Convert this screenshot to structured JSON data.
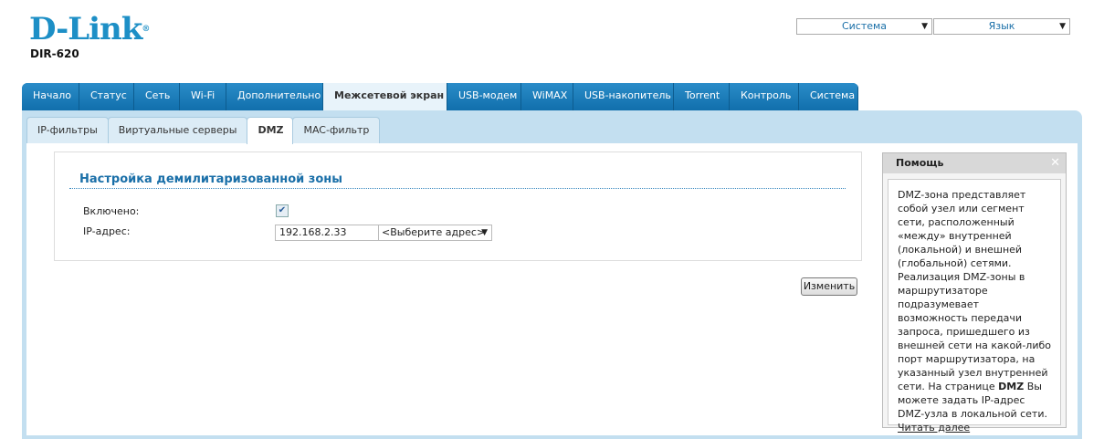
{
  "brand": {
    "logo": "D-Link",
    "model": "DIR-620"
  },
  "top": {
    "system": "Система",
    "language": "Язык"
  },
  "tabs": [
    "Начало",
    "Статус",
    "Сеть",
    "Wi-Fi",
    "Дополнительно",
    "Межсетевой экран",
    "USB-модем",
    "WiMAX",
    "USB-накопитель",
    "Torrent",
    "Контроль",
    "Система"
  ],
  "active_tab": "Межсетевой экран",
  "subtabs": [
    "IP-фильтры",
    "Виртуальные серверы",
    "DMZ",
    "MAC-фильтр"
  ],
  "form": {
    "title": "Настройка демилитаризованной зоны",
    "enabled_label": "Включено:",
    "enabled": true,
    "ip_label": "IP-адрес:",
    "ip_value": "192.168.2.33",
    "select_value": "<Выберите адрес>",
    "save": "Изменить"
  },
  "help": {
    "title": "Помощь",
    "text_1": "DMZ-зона представляет собой узел или сегмент сети, расположенный «между» внутренней (локальной) и внешней (глобальной) сетями. Реализация DMZ-зоны в маршрутизаторе подразумевает возможность передачи запроса, пришедшего из внешней сети на какой-либо порт маршрутизатора, на указанный узел внутренней сети. На странице ",
    "text_bold": "DMZ",
    "text_2": " Вы можете задать IP-адрес DMZ-узла в локальной сети.",
    "more": "Читать далее"
  }
}
